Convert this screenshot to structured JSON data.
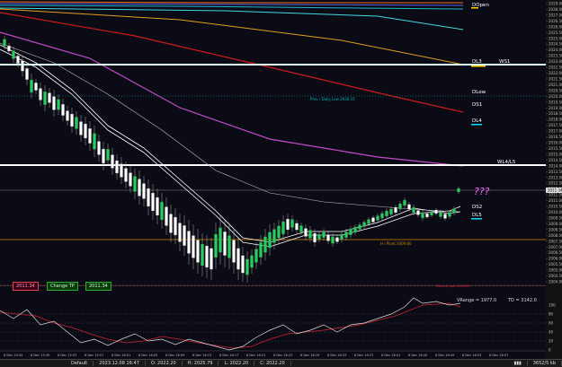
{
  "y_ticks": [
    "2029.00",
    "2028.00",
    "2027.00",
    "2026.50",
    "2026.00",
    "2025.50",
    "2025.00",
    "2024.50",
    "2024.00",
    "2023.50",
    "2023.00",
    "2022.50",
    "2022.00",
    "2021.50",
    "2021.00",
    "2020.50",
    "2020.00",
    "2019.50",
    "2019.00",
    "2018.50",
    "2018.00",
    "2017.50",
    "2017.00",
    "2016.50",
    "2016.00",
    "2015.50",
    "2015.00",
    "2014.50",
    "2014.00",
    "2013.50",
    "2013.00",
    "2012.50",
    "2012.00",
    "2011.50",
    "2011.00",
    "2010.50",
    "2010.00",
    "2009.50",
    "2009.00",
    "2008.50",
    "2008.00",
    "2007.50",
    "2007.00",
    "2006.50",
    "2006.00",
    "2005.50",
    "2005.00",
    "2004.50",
    "2004.00"
  ],
  "x_ticks": [
    "8 Dec 15:45",
    "8 Dec 15:49",
    "8 Dec 15:53",
    "8 Dec 15:57",
    "8 Dec 16:01",
    "8 Dec 16:05",
    "8 Dec 16:09",
    "8 Dec 16:13",
    "8 Dec 16:17",
    "8 Dec 16:21",
    "8 Dec 16:25",
    "8 Dec 16:29",
    "8 Dec 16:33",
    "8 Dec 16:37",
    "8 Dec 16:41",
    "8 Dec 16:45",
    "8 Dec 16:49",
    "8 Dec 16:53",
    "8 Dec 16:57"
  ],
  "levels": {
    "dopen": "DOpen",
    "dl3": "DL3",
    "ws1": "WS1",
    "dlow": "DLow",
    "ds1": "DS1",
    "dl4": "DL4",
    "wl4l5": "WL4/L5",
    "ds2": "DS2",
    "dl5": "DL5",
    "prev_daily_low": "Prev / Daily Low 2030.15",
    "pivot": "H / Pivot 2009.60",
    "bottom_line": "Monthly Low 2002.89"
  },
  "price_tag": "2011.34",
  "scribble": "???",
  "trade": {
    "left_value": "2011.34",
    "change_tp_label": "Change TP",
    "tp_value": "2011.34"
  },
  "indicator": {
    "vrange": "VRange = 1977.0",
    "td": "TD = 3142.0",
    "ticks": [
      "100",
      "80",
      "60",
      "40",
      "20",
      "0"
    ]
  },
  "status": {
    "profile": "Default",
    "datetime": "2023.12.08 16:47",
    "open": "O: 2022.20",
    "high": "H: 2025.79",
    "low": "L: 2022.20",
    "close": "C: 2022.20",
    "traffic": "3652/5 kb"
  },
  "colors": {
    "bg": "#0b0b16",
    "bull": "#1fd15a",
    "bear": "#ffffff",
    "level_line": "#ffffff",
    "dl3_line": "#ffffff",
    "ds2_line": "#ffffff",
    "prev_low": "#00b6b3",
    "pivot": "#d48800",
    "ma_red": "#cc1c1c",
    "ma_purple": "#c04ac8",
    "ma_orange": "#e0a020",
    "ma_cyan": "#1fb7d8"
  }
}
